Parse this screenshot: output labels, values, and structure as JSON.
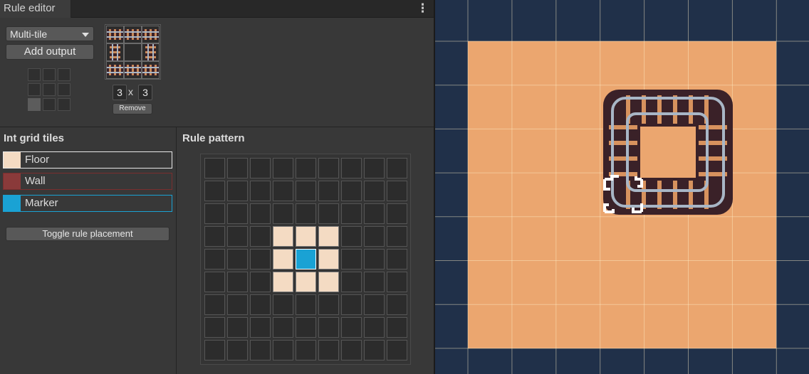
{
  "window": {
    "tab_title": "Rule editor",
    "menu_icon": "kebab-menu-icon"
  },
  "output": {
    "mode_selected": "Multi-tile",
    "add_output_label": "Add output",
    "mini_grid_selected": {
      "row": 2,
      "col": 0
    },
    "preview_size": {
      "cols": "3",
      "rows": "3"
    },
    "times_symbol": "x",
    "remove_label": "Remove"
  },
  "int_grid": {
    "title": "Int grid tiles",
    "tiles": [
      {
        "label": "Floor",
        "color": "#f4dbc3",
        "border": "#e8e8e8"
      },
      {
        "label": "Wall",
        "color": "#8a3a3a",
        "border": "#7a2e2e"
      },
      {
        "label": "Marker",
        "color": "#1aa2d4",
        "border": "#1aa2d4"
      }
    ],
    "toggle_label": "Toggle rule placement"
  },
  "pattern": {
    "title": "Rule pattern",
    "size": 9,
    "floor_cells": [
      [
        3,
        3
      ],
      [
        3,
        4
      ],
      [
        3,
        5
      ],
      [
        4,
        3
      ],
      [
        4,
        5
      ],
      [
        5,
        3
      ],
      [
        5,
        4
      ],
      [
        5,
        5
      ]
    ],
    "marker_cells": [
      [
        4,
        4
      ]
    ]
  },
  "colors": {
    "floor": "#eba66f",
    "background": "#203049",
    "editor_bg": "#383838"
  }
}
